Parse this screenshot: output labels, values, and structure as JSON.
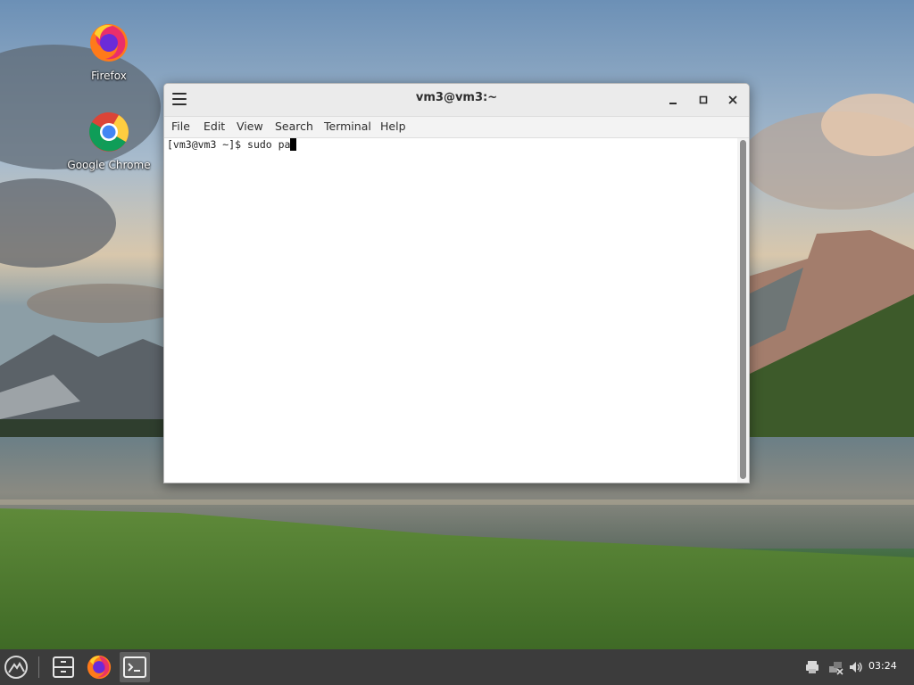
{
  "desktop": {
    "icons": [
      {
        "label": "Firefox",
        "icon": "firefox-icon"
      },
      {
        "label": "Google Chrome",
        "icon": "chrome-icon"
      }
    ]
  },
  "window": {
    "title": "vm3@vm3:~",
    "menu": [
      "File",
      "Edit",
      "View",
      "Search",
      "Terminal",
      "Help"
    ],
    "terminal": {
      "prompt": "[vm3@vm3 ~]$ ",
      "input": "sudo pa"
    }
  },
  "taskbar": {
    "clock": "03:24",
    "apps": [
      "app-menu-icon",
      "file-manager-icon",
      "firefox-icon",
      "terminal-icon"
    ],
    "tray": [
      "printer-icon",
      "network-disconnected-icon",
      "volume-icon"
    ]
  },
  "colors": {
    "taskbar": "#3c3c3c",
    "titlebar": "#ebebeb",
    "terminal_bg": "#ffffff",
    "active_task": "#5f5f5f"
  }
}
